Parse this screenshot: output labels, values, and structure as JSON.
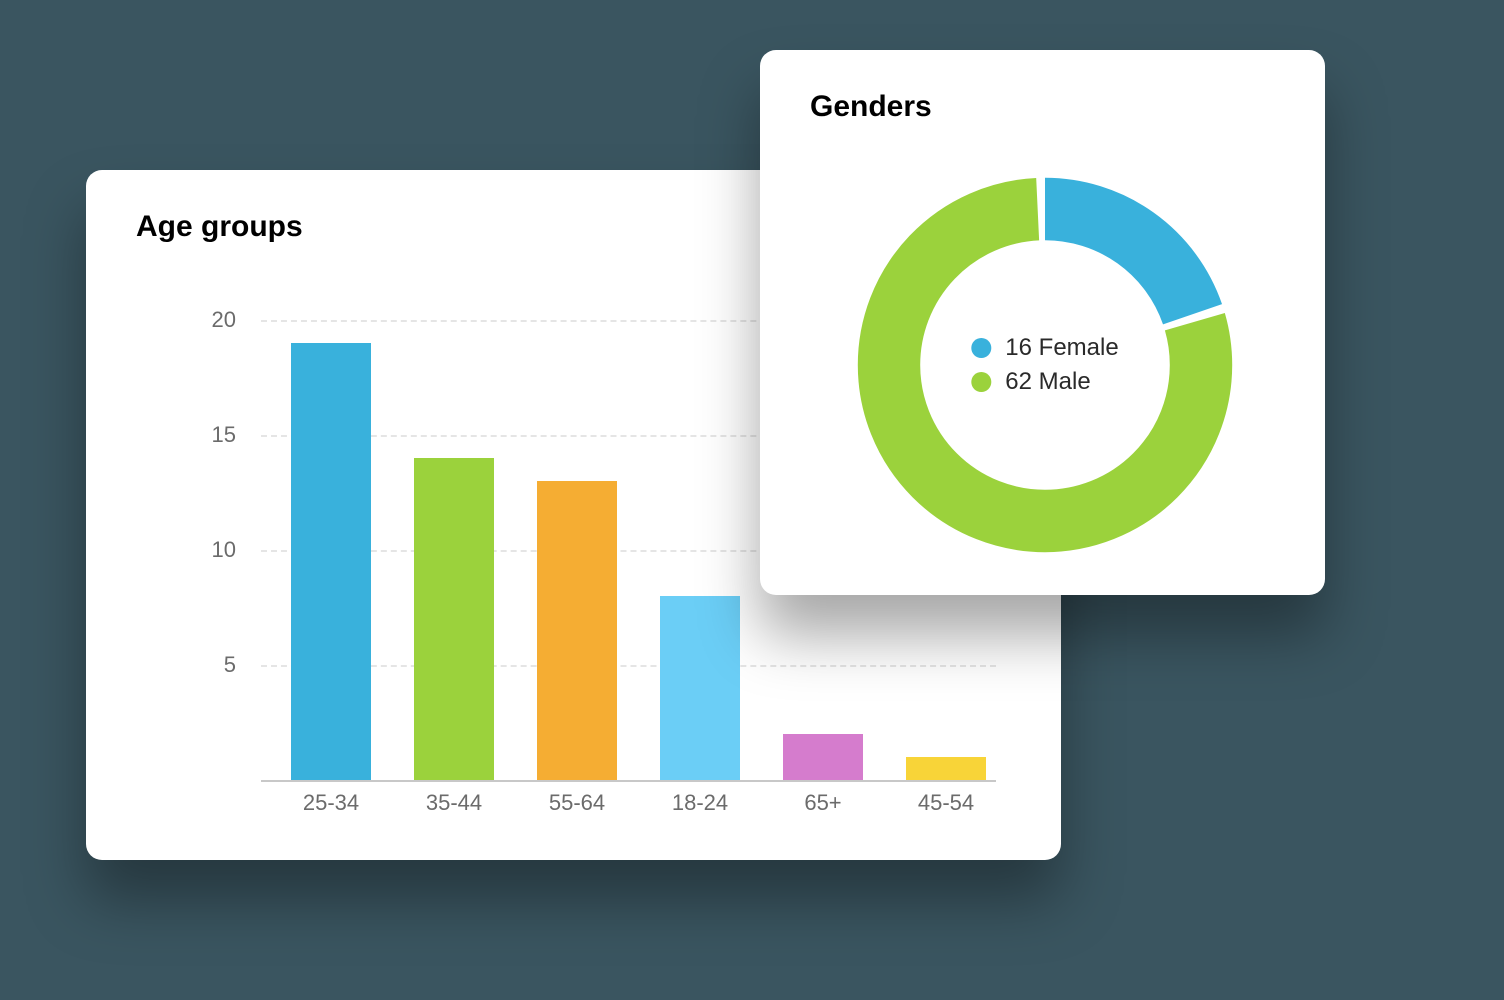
{
  "age_card": {
    "title": "Age groups"
  },
  "gender_card": {
    "title": "Genders",
    "legend": {
      "female": "16 Female",
      "male": "62 Male"
    }
  },
  "chart_data": [
    {
      "type": "bar",
      "title": "Age groups",
      "categories": [
        "25-34",
        "35-44",
        "55-64",
        "18-24",
        "65+",
        "45-54"
      ],
      "values": [
        19,
        14,
        13,
        8,
        2,
        1
      ],
      "colors": [
        "#39b1dc",
        "#9bd23c",
        "#f5ad33",
        "#6bcef6",
        "#d57ccd",
        "#f8d438"
      ],
      "ylim": [
        0,
        20
      ],
      "yticks": [
        5,
        10,
        15,
        20
      ],
      "xlabel": "",
      "ylabel": ""
    },
    {
      "type": "pie",
      "title": "Genders",
      "series": [
        {
          "name": "Female",
          "value": 16,
          "color": "#39b1dc"
        },
        {
          "name": "Male",
          "value": 62,
          "color": "#9bd23c"
        }
      ]
    }
  ]
}
